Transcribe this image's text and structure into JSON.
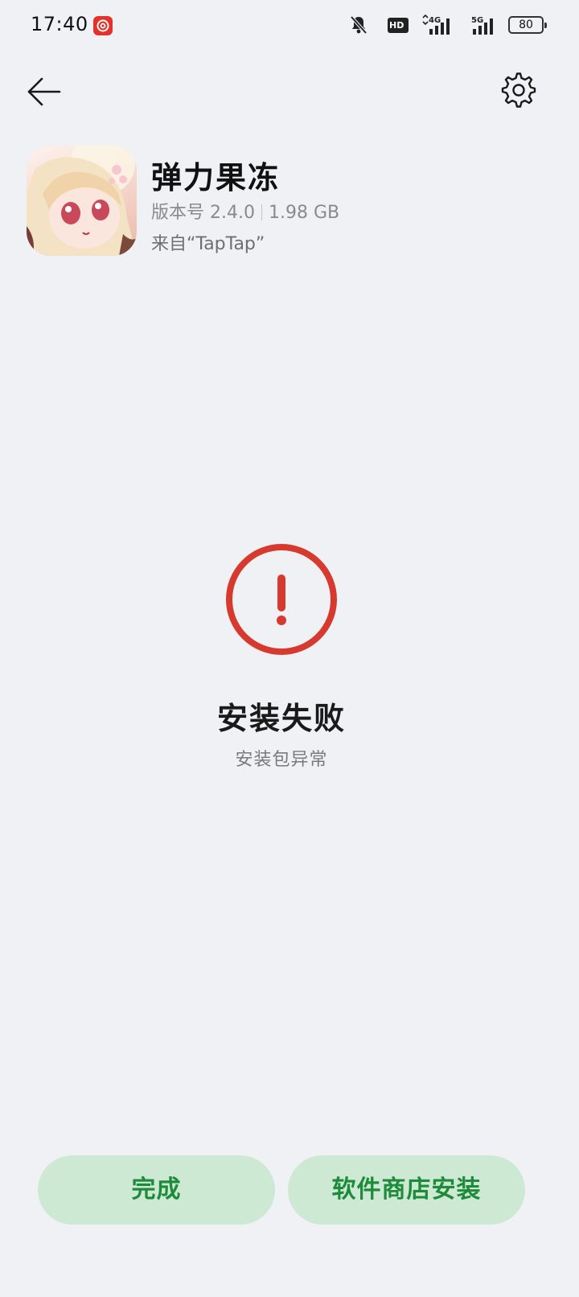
{
  "status_bar": {
    "time": "17:40",
    "network_1": "4G",
    "network_2": "5G",
    "hd_label": "HD",
    "battery": "80"
  },
  "app": {
    "name": "弹力果冻",
    "version": "版本号 2.4.0",
    "size": "1.98 GB",
    "source": "来自“TapTap”"
  },
  "result": {
    "title": "安装失败",
    "subtitle": "安装包异常",
    "icon": "error-exclamation-icon",
    "color": "#d63a2f"
  },
  "actions": {
    "done_label": "完成",
    "store_install_label": "软件商店安装",
    "button_bg": "#cde9d4",
    "button_text_color": "#1e8b3a"
  }
}
